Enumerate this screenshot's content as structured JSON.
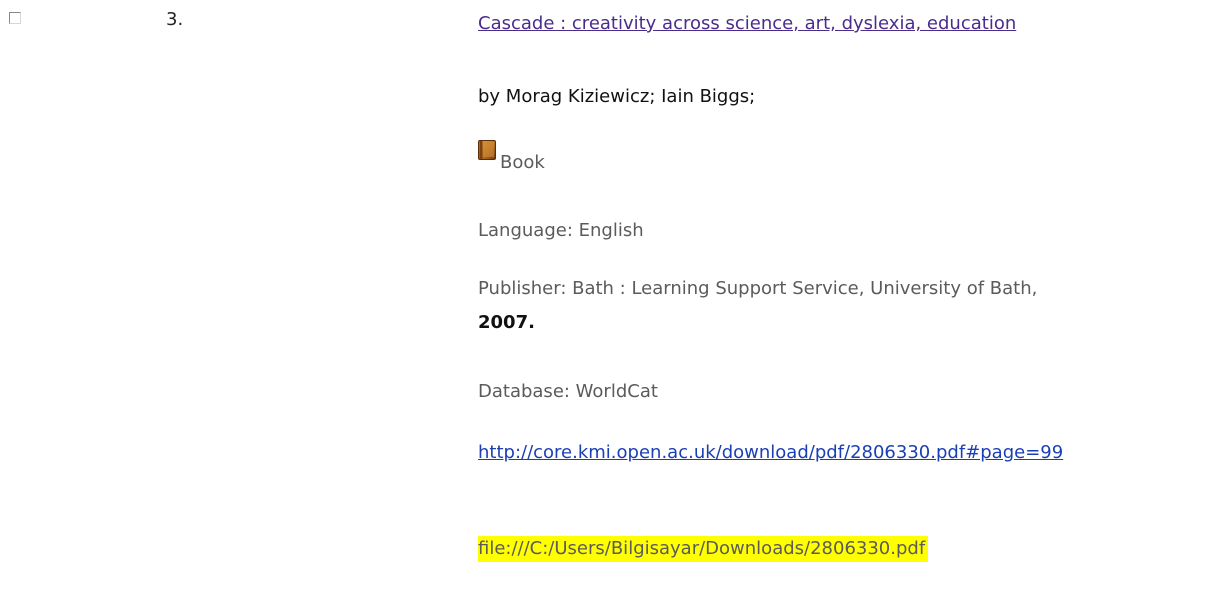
{
  "result": {
    "index": "3.",
    "title": "Cascade : creativity across science, art, dyslexia, education",
    "authors": "by Morag Kiziewicz; Iain Biggs;",
    "format": {
      "icon": "book-icon",
      "label": "Book"
    },
    "language": "Language: English",
    "publisher": "Publisher: Bath : Learning Support Service, University of Bath,",
    "year": "2007.",
    "database": "Database: WorldCat",
    "url": "http://core.kmi.open.ac.uk/download/pdf/2806330.pdf#page=99",
    "file_link": "file:///C:/Users/Bilgisayar/Downloads/2806330.pdf"
  },
  "colors": {
    "title_link": "#4a2c8c",
    "url_link": "#1a3fb5",
    "highlight": "#ffff00"
  }
}
